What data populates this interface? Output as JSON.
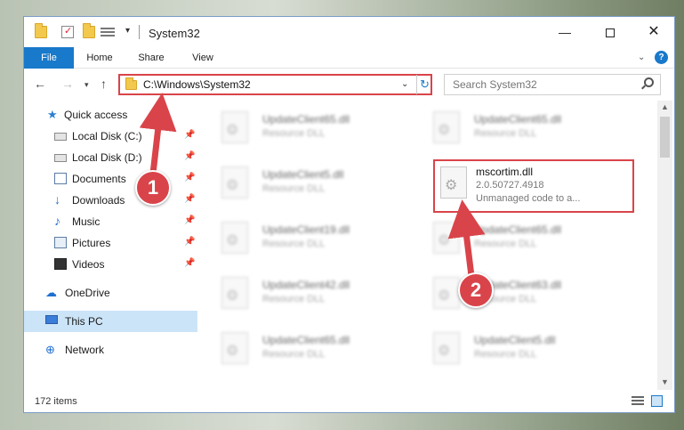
{
  "window": {
    "title": "System32",
    "qat_dropdown": "▾",
    "minimize": "—",
    "close": "✕"
  },
  "ribbon": {
    "file": "File",
    "home": "Home",
    "share": "Share",
    "view": "View",
    "expand": "⌄",
    "help": "?"
  },
  "navigation": {
    "back": "←",
    "forward": "→",
    "recent": "▾",
    "up": "↑",
    "address": "C:\\Windows\\System32",
    "address_dropdown": "⌄",
    "refresh": "↻",
    "search_placeholder": "Search System32"
  },
  "sidebar": {
    "items": [
      {
        "label": "Quick access",
        "icon": "star-icon",
        "pinned": false
      },
      {
        "label": "Local Disk (C:)",
        "icon": "drive-icon",
        "pinned": true
      },
      {
        "label": "Local Disk (D:)",
        "icon": "drive-icon",
        "pinned": true
      },
      {
        "label": "Documents",
        "icon": "documents-icon",
        "pinned": true
      },
      {
        "label": "Downloads",
        "icon": "download-icon",
        "pinned": true
      },
      {
        "label": "Music",
        "icon": "music-icon",
        "pinned": true
      },
      {
        "label": "Pictures",
        "icon": "pictures-icon",
        "pinned": true
      },
      {
        "label": "Videos",
        "icon": "videos-icon",
        "pinned": true
      },
      {
        "label": "OneDrive",
        "icon": "cloud-icon",
        "pinned": false
      },
      {
        "label": "This PC",
        "icon": "computer-icon",
        "pinned": false,
        "selected": true
      },
      {
        "label": "Network",
        "icon": "network-icon",
        "pinned": false
      }
    ],
    "pin_glyph": "📌"
  },
  "files": {
    "left_column": [
      {
        "name": "UpdateClient65.dll",
        "desc": "Resource DLL"
      },
      {
        "name": "UpdateClient5.dll",
        "desc": "Resource DLL"
      },
      {
        "name": "UpdateClient19.dll",
        "desc": "Resource DLL"
      },
      {
        "name": "UpdateClient42.dll",
        "desc": "Resource DLL"
      },
      {
        "name": "UpdateClient65.dll",
        "desc": "Resource DLL"
      }
    ],
    "right_column": [
      {
        "name": "UpdateClient65.dll",
        "desc": "Resource DLL"
      },
      {
        "name": "UpdateClient65.dll",
        "desc": "Resource DLL"
      },
      {
        "name": "UpdateClient63.dll",
        "desc": "Resource DLL"
      },
      {
        "name": "UpdateClient5.dll",
        "desc": "Resource DLL"
      }
    ],
    "highlighted": {
      "name": "mscortim.dll",
      "version": "2.0.50727.4918",
      "desc": "Unmanaged code to a..."
    }
  },
  "scrollbar": {
    "up": "▲",
    "down": "▼"
  },
  "status": {
    "item_count": "172 items"
  },
  "annotations": {
    "step1": "1",
    "step2": "2"
  },
  "colors": {
    "accent": "#1979ca",
    "highlight_red": "#d9444a",
    "selected_bg": "#cce4f7"
  }
}
